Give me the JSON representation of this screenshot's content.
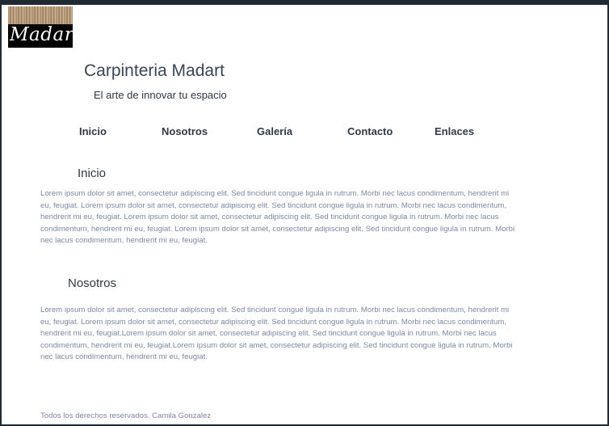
{
  "logo": {
    "text": "Madart"
  },
  "header": {
    "title": "Carpinteria Madart",
    "tagline": "El arte de innovar tu espacio"
  },
  "nav": {
    "items": [
      {
        "label": "Inicio"
      },
      {
        "label": "Nosotros"
      },
      {
        "label": "Galería"
      },
      {
        "label": "Contacto"
      },
      {
        "label": "Enlaces"
      }
    ]
  },
  "sections": {
    "inicio": {
      "heading": "Inicio",
      "text": "Lorem ipsum dolor sit amet, consectetur adipiscing elit. Sed tincidunt congue ligula in rutrum. Morbi nec lacus condimentum, hendrerit mi eu, feugiat. Lorem ipsum dolor sit amet, consectetur adipiscing elit. Sed tincidunt congue ligula in rutrum. Morbi nec lacus condimentum, hendrerit mi eu, feugiat. Lorem ipsum dolor sit amet, consectetur adipiscing elit. Sed tincidunt congue ligula in rutrum. Morbi nec lacus condimentum, hendrerit mi eu, feugiat. Lorem ipsum dolor sit amet, consectetur adipiscing elit. Sed tincidunt congue ligula in rutrum. Morbi nec lacus condimentum, hendrerit mi eu, feugiat."
    },
    "nosotros": {
      "heading": "Nosotros",
      "text": "Lorem ipsum dolor sit amet, consectetur adipiscing elit. Sed tincidunt congue ligula in rutrum. Morbi nec lacus condimentum, hendrerit mi eu, feugiat. Lorem ipsum dolor sit amet, consectetur adipiscing elit. Sed tincidunt congue ligula in rutrum. Morbi nec lacus condimentum, hendrerit mi eu, feugiat.Lorem ipsum dolor sit amet, consectetur adipiscing elit. Sed tincidunt congue ligula in rutrum. Morbi nec lacus condimentum, hendrerit mi eu, feugiat.Lorem ipsum dolor sit amet, consectetur adipiscing elit. Sed tincidunt congue ligula in rutrum. Morbi nec lacus condimentum, hendrerit mi eu, feugiat."
    }
  },
  "footer": {
    "text": "Todos los derechos reservados. Camila Gonzalez"
  }
}
